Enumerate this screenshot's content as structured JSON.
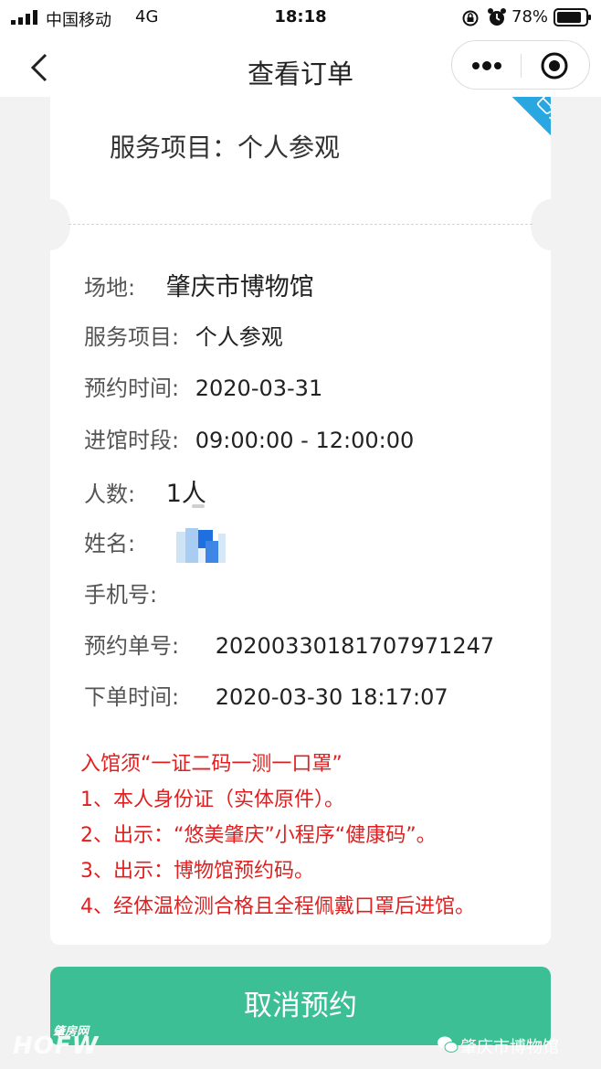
{
  "status_bar": {
    "carrier": "中国移动",
    "network": "4G",
    "time": "18:18",
    "battery": "78%"
  },
  "nav": {
    "title": "查看订单"
  },
  "card": {
    "badge": "已接单",
    "service_header": "服务项目：个人参观",
    "rows": {
      "venue_label": "场地:",
      "venue_value": "肇庆市博物馆",
      "service_label": "服务项目:",
      "service_value": "个人参观",
      "date_label": "预约时间:",
      "date_value": "2020-03-31",
      "slot_label": "进馆时段:",
      "slot_value": "09:00:00 - 12:00:00",
      "people_label": "人数:",
      "people_value": "1人",
      "name_label": "姓名:",
      "phone_label": "手机号:",
      "order_no_label": "预约单号:",
      "order_no_value": "20200330181707971247",
      "order_time_label": "下单时间:",
      "order_time_value": "2020-03-30 18:17:07"
    },
    "notice": [
      "入馆须“一证二码一测一口罩”",
      "1、本人身份证（实体原件）。",
      "2、出示：“悠美肇庆”小程序“健康码”。",
      "3、出示：博物馆预约码。",
      "4、经体温检测合格且全程佩戴口罩后进馆。"
    ]
  },
  "actions": {
    "cancel_label": "取消预约"
  },
  "watermark": {
    "left_top": "肇房网",
    "left_main": "HOFW",
    "right": "肇庆市博物馆"
  },
  "colors": {
    "accent_green": "#3cbf94",
    "badge_blue": "#2aa6e0",
    "notice_red": "#e02020"
  }
}
